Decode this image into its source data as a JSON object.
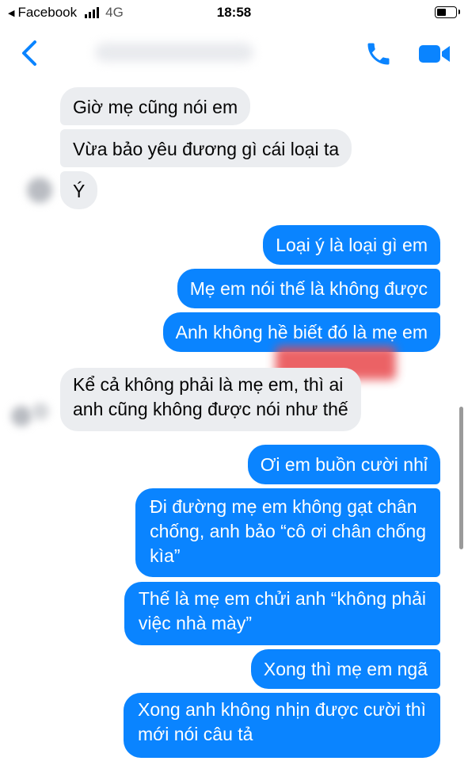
{
  "status_bar": {
    "back_app": "Facebook",
    "network": "4G",
    "time": "18:58",
    "battery_level": 0.5
  },
  "nav": {
    "back_icon": "chevron-left-icon",
    "call_icon": "phone-icon",
    "video_icon": "video-camera-icon",
    "accent": "#0a84ff"
  },
  "messages": [
    {
      "side": "in",
      "text": "Giờ mẹ cũng nói em"
    },
    {
      "side": "in",
      "text": "Vừa bảo yêu đương gì cái loại ta"
    },
    {
      "side": "in",
      "text": "Ý"
    },
    {
      "side": "out",
      "text": "Loại ý là loại gì em"
    },
    {
      "side": "out",
      "text": "Mẹ em nói thế là không được"
    },
    {
      "side": "out",
      "text": "Anh không hề biết đó là mẹ em"
    },
    {
      "side": "in",
      "lines": [
        "Kể cả không phải là mẹ em, thì ai",
        "anh cũng không được nói như thế"
      ]
    },
    {
      "side": "out",
      "text": "Ơi em buồn cười nhỉ"
    },
    {
      "side": "out",
      "lines": [
        "Đi đường mẹ em không gạt chân",
        "chống, anh bảo “cô ơi chân chống",
        "kìa”"
      ]
    },
    {
      "side": "out",
      "lines": [
        "Thế là mẹ em chửi anh “không phải",
        "việc nhà mày”"
      ]
    },
    {
      "side": "out",
      "text": "Xong thì mẹ em ngã"
    },
    {
      "side": "out",
      "lines": [
        "Xong anh không nhịn được cười thì",
        "mới nói câu tả"
      ]
    }
  ],
  "colors": {
    "incoming_bubble": "#ebedf0",
    "outgoing_bubble": "#0a84ff"
  }
}
